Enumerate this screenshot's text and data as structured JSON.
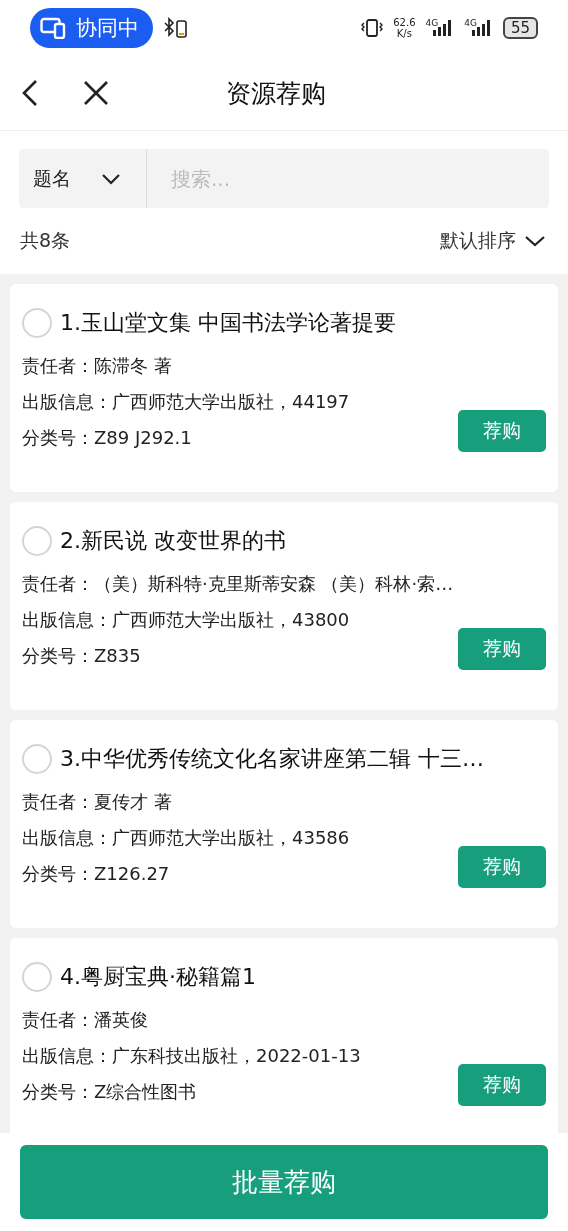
{
  "status_bar": {
    "collab": "协同中",
    "speed": "62.6",
    "speed_unit": "K/s",
    "networks": [
      "4G",
      "4G"
    ],
    "battery": "55"
  },
  "header": {
    "title": "资源荐购"
  },
  "search": {
    "field": "题名",
    "placeholder": "搜索..."
  },
  "summary": {
    "count": "共8条",
    "sort": "默认排序"
  },
  "items": [
    {
      "title": "1.玉山堂文集 中国书法学论著提要",
      "selected": false,
      "lines": [
        "责任者：陈滞冬 著",
        "出版信息：广西师范大学出版社，44197",
        "分类号：Z89 J292.1"
      ],
      "action": "荐购"
    },
    {
      "title": "2.新民说 改变世界的书",
      "selected": false,
      "lines": [
        "责任者：（美）斯科特·克里斯蒂安森 （美）科林·索…",
        "出版信息：广西师范大学出版社，43800",
        "分类号：Z835"
      ],
      "action": "荐购"
    },
    {
      "title": "3.中华优秀传统文化名家讲座第二辑 十三…",
      "selected": false,
      "lines": [
        "责任者：夏传才 著",
        "出版信息：广西师范大学出版社，43586",
        "分类号：Z126.27"
      ],
      "action": "荐购"
    },
    {
      "title": "4.粤厨宝典·秘籍篇1",
      "selected": false,
      "lines": [
        "责任者：潘英俊",
        "出版信息：广东科技出版社，2022-01-13",
        "分类号：Z综合性图书"
      ],
      "action": "荐购"
    }
  ],
  "bottom_button": "批量荐购"
}
